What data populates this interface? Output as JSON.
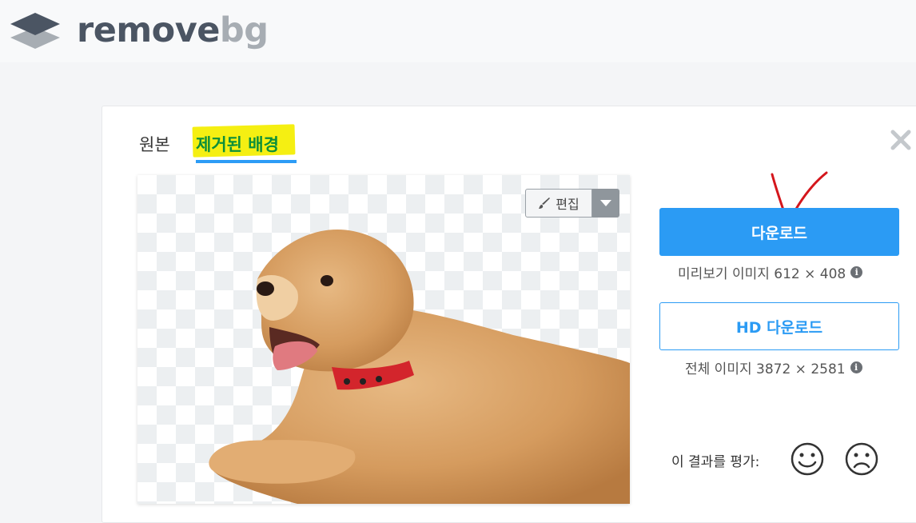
{
  "header": {
    "logo_remove": "remove",
    "logo_bg": "bg"
  },
  "tabs": {
    "original": "원본",
    "removed": "제거된 배경"
  },
  "editor": {
    "edit_label": "편집"
  },
  "download": {
    "button_label": "다운로드",
    "preview_info": "미리보기 이미지 612 × 408",
    "hd_button_label": "HD 다운로드",
    "full_info": "전체 이미지 3872 × 2581"
  },
  "rating": {
    "label": "이 결과를 평가:"
  },
  "icons": {
    "logo": "layers-icon",
    "close": "close-icon",
    "edit": "brush-icon",
    "caret": "caret-down-icon",
    "info": "info-icon",
    "happy": "smiley-happy-icon",
    "sad": "smiley-sad-icon",
    "annotation": "red-checkmark-annotation"
  },
  "colors": {
    "accent": "#2b9bf4",
    "tab_active_text": "#0c8f3a",
    "highlight": "#f5ef12"
  }
}
